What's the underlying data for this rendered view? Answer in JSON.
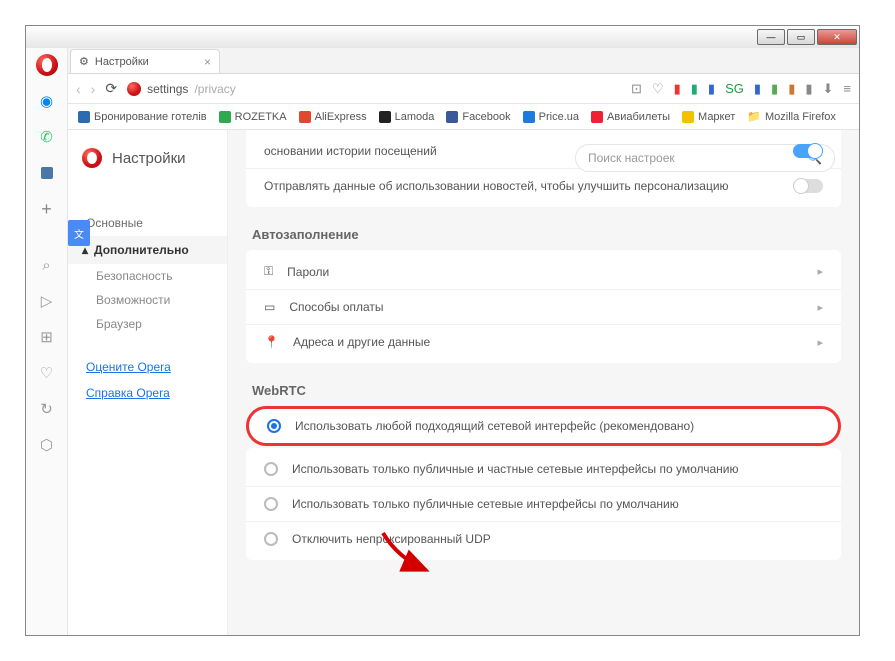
{
  "window": {
    "tab_title": "Настройки"
  },
  "address": {
    "main": "settings",
    "path": "/privacy"
  },
  "bookmarks": [
    {
      "label": "Бронирование гoтелів",
      "color": "#2b6cb0"
    },
    {
      "label": "ROZETKA",
      "color": "#2fa84f"
    },
    {
      "label": "AliExpress",
      "color": "#e2472f"
    },
    {
      "label": "Lamoda",
      "color": "#222"
    },
    {
      "label": "Facebook",
      "color": "#3b5998"
    },
    {
      "label": "Price.ua",
      "color": "#1f7ae0"
    },
    {
      "label": "Авиабилеты",
      "color": "#e23"
    },
    {
      "label": "Маркет",
      "color": "#f2c200"
    },
    {
      "label": "Mozilla Firefox",
      "color": "#999"
    }
  ],
  "sidebar": {
    "title": "Настройки",
    "basic": "Основные",
    "advanced": "Дополнительно",
    "subs": [
      "Безопасность",
      "Возможности",
      "Браузер"
    ],
    "rate": "Оцените Opera",
    "help": "Справка Opera"
  },
  "search": {
    "placeholder": "Поиск настроек"
  },
  "top_rows": {
    "r1": "основании истории посещений",
    "r2": "Отправлять данные об использовании новостей, чтобы улучшить персонализацию"
  },
  "autofill": {
    "title": "Автозаполнение",
    "rows": [
      "Пароли",
      "Способы оплаты",
      "Адреса и другие данные"
    ]
  },
  "webrtc": {
    "title": "WebRTC",
    "options": [
      "Использовать любой подходящий сетевой интерфейс (рекомендовано)",
      "Использовать только публичные и частные сетевые интерфейсы по умолчанию",
      "Использовать только публичные сетевые интерфейсы по умолчанию",
      "Отключить непроксированный UDP"
    ]
  }
}
